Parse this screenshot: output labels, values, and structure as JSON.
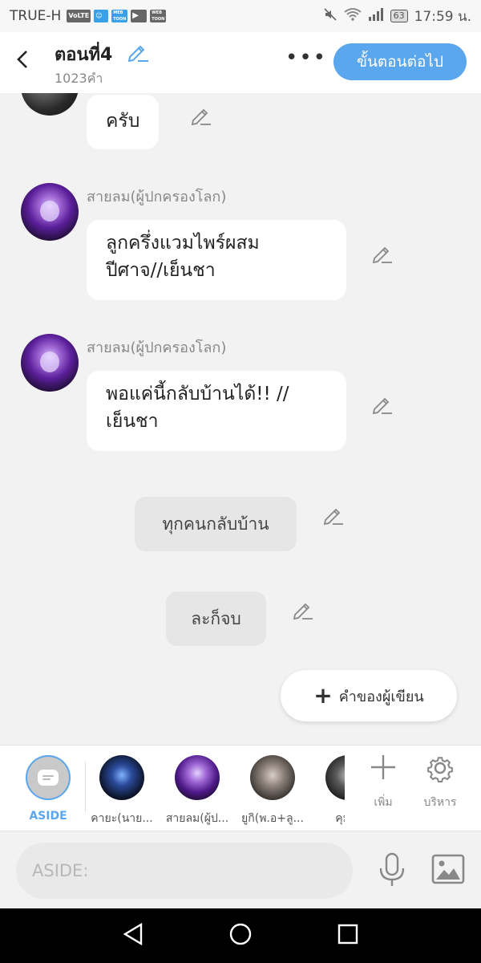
{
  "status_bar": {
    "carrier": "TRUE-H",
    "icons": [
      "volte-icon",
      "person-icon",
      "meb-toon-icon",
      "youtube-icon",
      "webtoon-icon"
    ],
    "mini_labels": [
      "VoLTE",
      "MEB TOON",
      "WEB TOON"
    ],
    "battery": "63",
    "time": "17:59 น."
  },
  "header": {
    "back_icon": "chevron-left-icon",
    "title": "ตอนที่4",
    "word_count": "1023คำ",
    "more_icon": "more-horizontal-icon",
    "next_button": "ขั้นตอนต่อไป"
  },
  "chat": {
    "messages": [
      {
        "type": "bubble",
        "speaker": "",
        "text": "ครับ"
      },
      {
        "type": "bubble",
        "speaker": "สายลม(ผู้ปกครองโลก)",
        "text_lines": [
          "ลูกครึ่งแวมไพร์ผสม",
          "ปีศาจ//เย็นชา"
        ]
      },
      {
        "type": "bubble",
        "speaker": "สายลม(ผู้ปกครองโลก)",
        "text_lines": [
          "พอแค่นี้กลับบ้านได้!! //",
          "เย็นชา"
        ]
      },
      {
        "type": "narration",
        "text": "ทุกคนกลับบ้าน"
      },
      {
        "type": "narration",
        "text": "ละก็จบ"
      }
    ],
    "author_note_button": "คำของผู้เขียน"
  },
  "character_bar": {
    "aside_label": "ASIDE",
    "characters": [
      {
        "name": "คายะ(นาย..."
      },
      {
        "name": "สายลม(ผู้ป..."
      },
      {
        "name": "ยูกิ(พ.อ+ลู..."
      },
      {
        "name": "คุมะ("
      }
    ],
    "add_label": "เพิ่ม",
    "settings_label": "บริหาร"
  },
  "input": {
    "placeholder": "ASIDE:"
  },
  "colors": {
    "accent": "#5aa7ee",
    "background": "#f2f2f2",
    "bubble": "#ffffff",
    "narration": "#e6e6e6"
  }
}
